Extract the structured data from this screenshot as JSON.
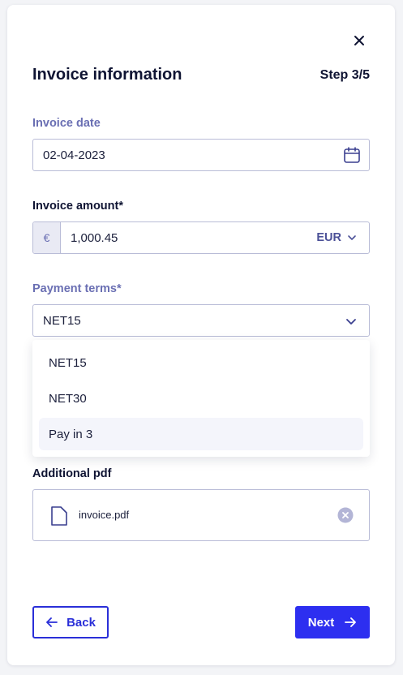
{
  "header": {
    "title": "Invoice information",
    "step": "Step 3/5",
    "close_icon": "close-icon"
  },
  "invoice_date": {
    "label": "Invoice date",
    "value": "02-04-2023",
    "icon": "calendar-icon"
  },
  "invoice_amount": {
    "label": "Invoice amount*",
    "currency_symbol": "€",
    "value": "1,000.45",
    "currency": "EUR"
  },
  "payment_terms": {
    "label": "Payment terms*",
    "selected": "NET15",
    "options": [
      "NET15",
      "NET30",
      "Pay in 3"
    ],
    "highlighted_option": "Pay in 3"
  },
  "additional_pdf": {
    "label": "Additional pdf",
    "file_name": "invoice.pdf",
    "file_icon": "file-icon",
    "remove_icon": "remove-circle-icon"
  },
  "footer": {
    "back_label": "Back",
    "next_label": "Next"
  },
  "colors": {
    "primary": "#2d2ff0",
    "muted_label": "#6a6fb3",
    "border": "#b9bcd7"
  }
}
